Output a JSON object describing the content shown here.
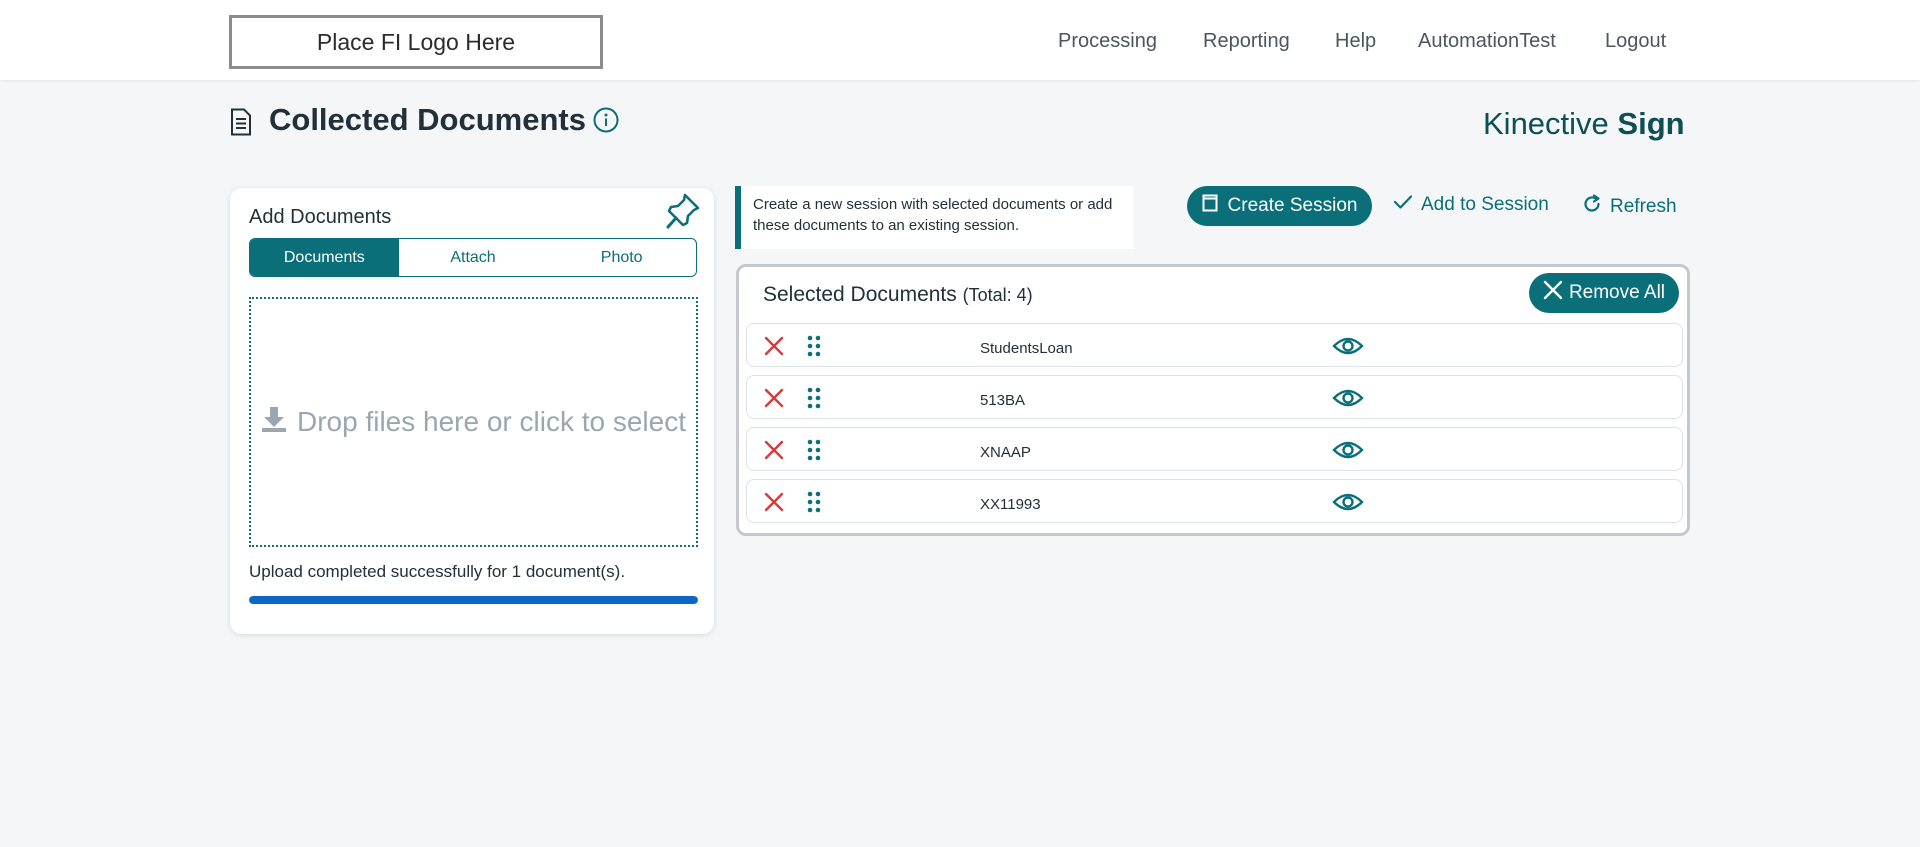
{
  "header": {
    "logo_text": "Place FI Logo Here",
    "nav": [
      "Processing",
      "Reporting",
      "Help",
      "AutomationTest",
      "Logout"
    ]
  },
  "page": {
    "title": "Collected Documents",
    "brand_light": "Kinective",
    "brand_bold": "Sign"
  },
  "add_documents": {
    "title": "Add Documents",
    "tabs": [
      "Documents",
      "Attach",
      "Photo"
    ],
    "active_tab": "Documents",
    "dropzone_text": "Drop files here or click to select",
    "status": "Upload completed successfully for 1 document(s).",
    "progress": 1.0
  },
  "actions": {
    "info_text": "Create a new session with selected documents or add these documents to an existing session.",
    "create_session": "Create Session",
    "add_to_session": "Add to Session",
    "refresh": "Refresh"
  },
  "selected": {
    "title": "Selected Documents",
    "total_label": "(Total: 4)",
    "remove_all": "Remove All",
    "documents": [
      "StudentsLoan",
      "513BA",
      "XNAAP",
      "XX11993"
    ]
  },
  "colors": {
    "accent": "#0b6f7a",
    "danger": "#d63a3a",
    "progress": "#0a67c4",
    "background": "#f4f6f8"
  }
}
